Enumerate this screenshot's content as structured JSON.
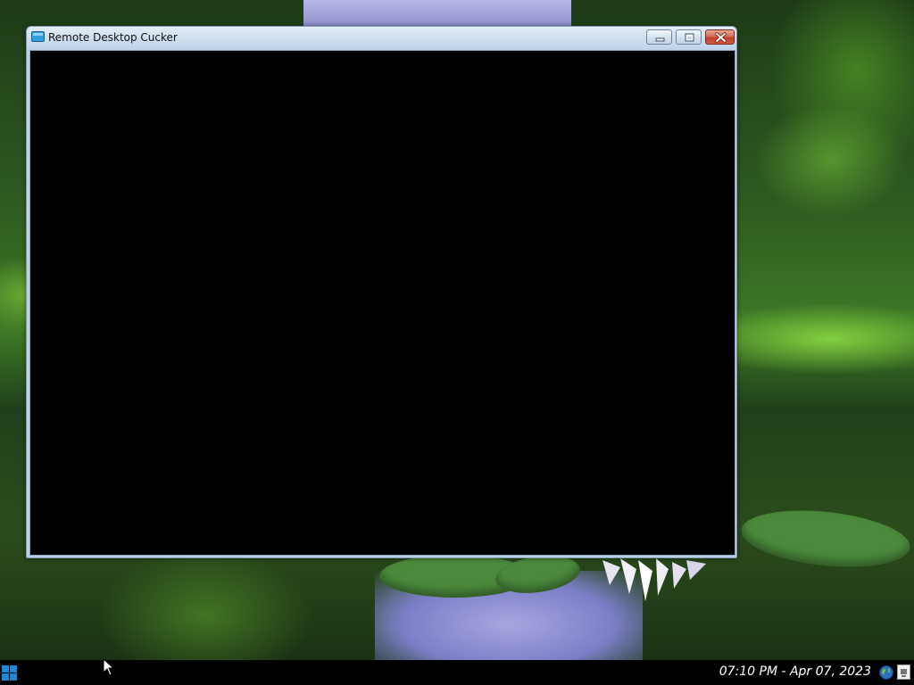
{
  "window": {
    "title": "Remote Desktop Cucker",
    "icon": "window-app-icon",
    "controls": {
      "minimize": "minimize-icon",
      "maximize": "maximize-icon",
      "close": "close-icon"
    },
    "content_color": "#000000"
  },
  "taskbar": {
    "start_icon": "windows-logo-icon",
    "clock": "07:10 PM - Apr 07, 2023",
    "tray_icons": [
      "globe-icon",
      "notification-icon"
    ],
    "accent": "#1e88d8"
  },
  "desktop": {
    "wallpaper": "forest-pond-water-lily"
  }
}
